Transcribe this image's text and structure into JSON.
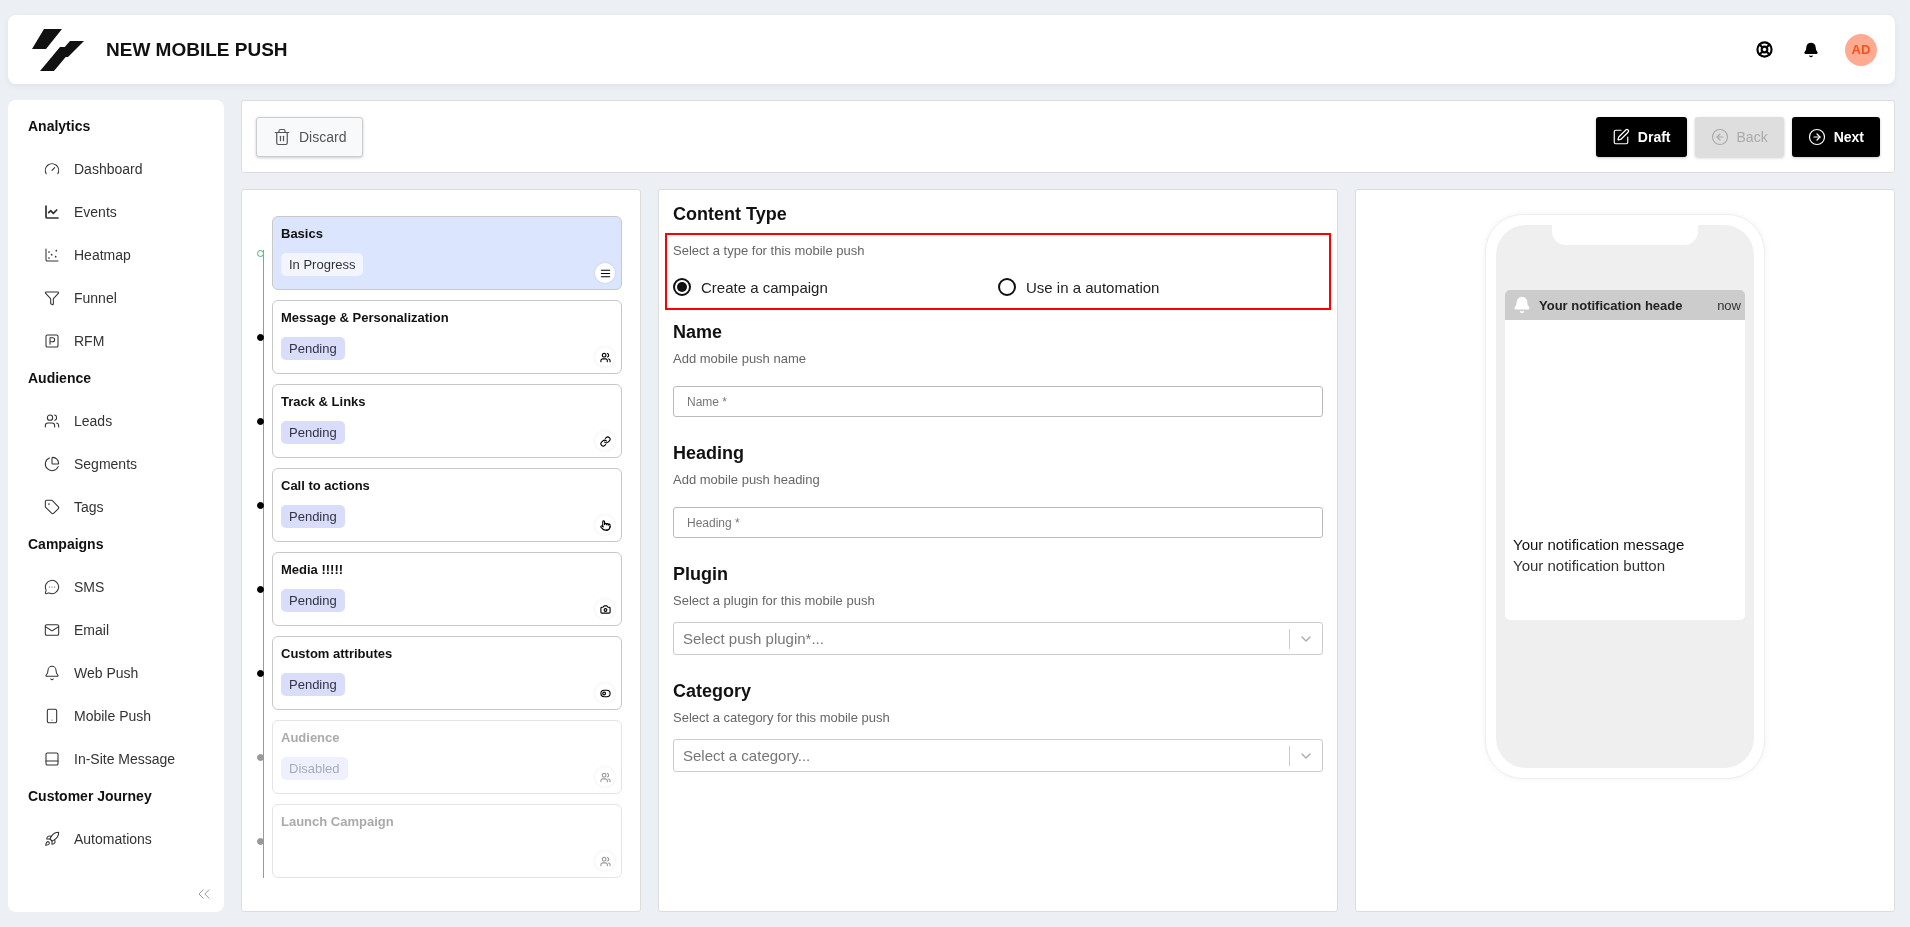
{
  "header": {
    "title": "NEW MOBILE PUSH",
    "avatar": "AD"
  },
  "sidebar": {
    "sections": [
      {
        "title": "Analytics",
        "items": [
          {
            "label": "Dashboard"
          },
          {
            "label": "Events"
          },
          {
            "label": "Heatmap"
          },
          {
            "label": "Funnel"
          },
          {
            "label": "RFM"
          }
        ]
      },
      {
        "title": "Audience",
        "items": [
          {
            "label": "Leads"
          },
          {
            "label": "Segments"
          },
          {
            "label": "Tags"
          }
        ]
      },
      {
        "title": "Campaigns",
        "items": [
          {
            "label": "SMS"
          },
          {
            "label": "Email"
          },
          {
            "label": "Web Push"
          },
          {
            "label": "Mobile Push"
          },
          {
            "label": "In-Site Message"
          }
        ]
      },
      {
        "title": "Customer Journey",
        "items": [
          {
            "label": "Automations"
          }
        ]
      }
    ]
  },
  "toolbar": {
    "buttons": [
      {
        "kind": "discard",
        "label": "Discard",
        "disabled": false
      },
      {
        "kind": "draft",
        "label": "Draft",
        "disabled": false
      },
      {
        "kind": "back",
        "label": "Back",
        "disabled": true
      },
      {
        "kind": "next",
        "label": "Next",
        "disabled": false
      }
    ]
  },
  "steps": [
    {
      "title": "Basics",
      "status": "In Progress",
      "selected": true,
      "disabled": false
    },
    {
      "title": "Message & Personalization",
      "status": "Pending",
      "selected": false,
      "disabled": false
    },
    {
      "title": "Track & Links",
      "status": "Pending",
      "selected": false,
      "disabled": false
    },
    {
      "title": "Call to actions",
      "status": "Pending",
      "selected": false,
      "disabled": false
    },
    {
      "title": "Media !!!!!",
      "status": "Pending",
      "selected": false,
      "disabled": false
    },
    {
      "title": "Custom attributes",
      "status": "Pending",
      "selected": false,
      "disabled": false
    },
    {
      "title": "Audience",
      "status": "Disabled",
      "selected": false,
      "disabled": true
    },
    {
      "title": "Launch Campaign",
      "selected": false,
      "disabled": true
    }
  ],
  "form": {
    "sections": [
      {
        "kind": "radio",
        "title": "Content Type",
        "hint": "Select a type for this mobile push",
        "options": [
          {
            "label": "Create a campaign",
            "selected": true
          },
          {
            "label": "Use in a automation",
            "selected": false
          }
        ]
      },
      {
        "kind": "text",
        "title": "Name",
        "hint": "Add mobile push name",
        "placeholder": "Name *"
      },
      {
        "kind": "text",
        "title": "Heading",
        "hint": "Add mobile push heading",
        "placeholder": "Heading *"
      },
      {
        "kind": "select",
        "title": "Plugin",
        "hint": "Select a plugin for this mobile push",
        "placeholder": "Select push plugin*..."
      },
      {
        "kind": "select",
        "title": "Category",
        "hint": "Select a category for this mobile push",
        "placeholder": "Select a category..."
      }
    ]
  },
  "preview": {
    "header": "Your notification heade",
    "time": "now",
    "message": "Your notification message",
    "button": "Your notification button"
  }
}
